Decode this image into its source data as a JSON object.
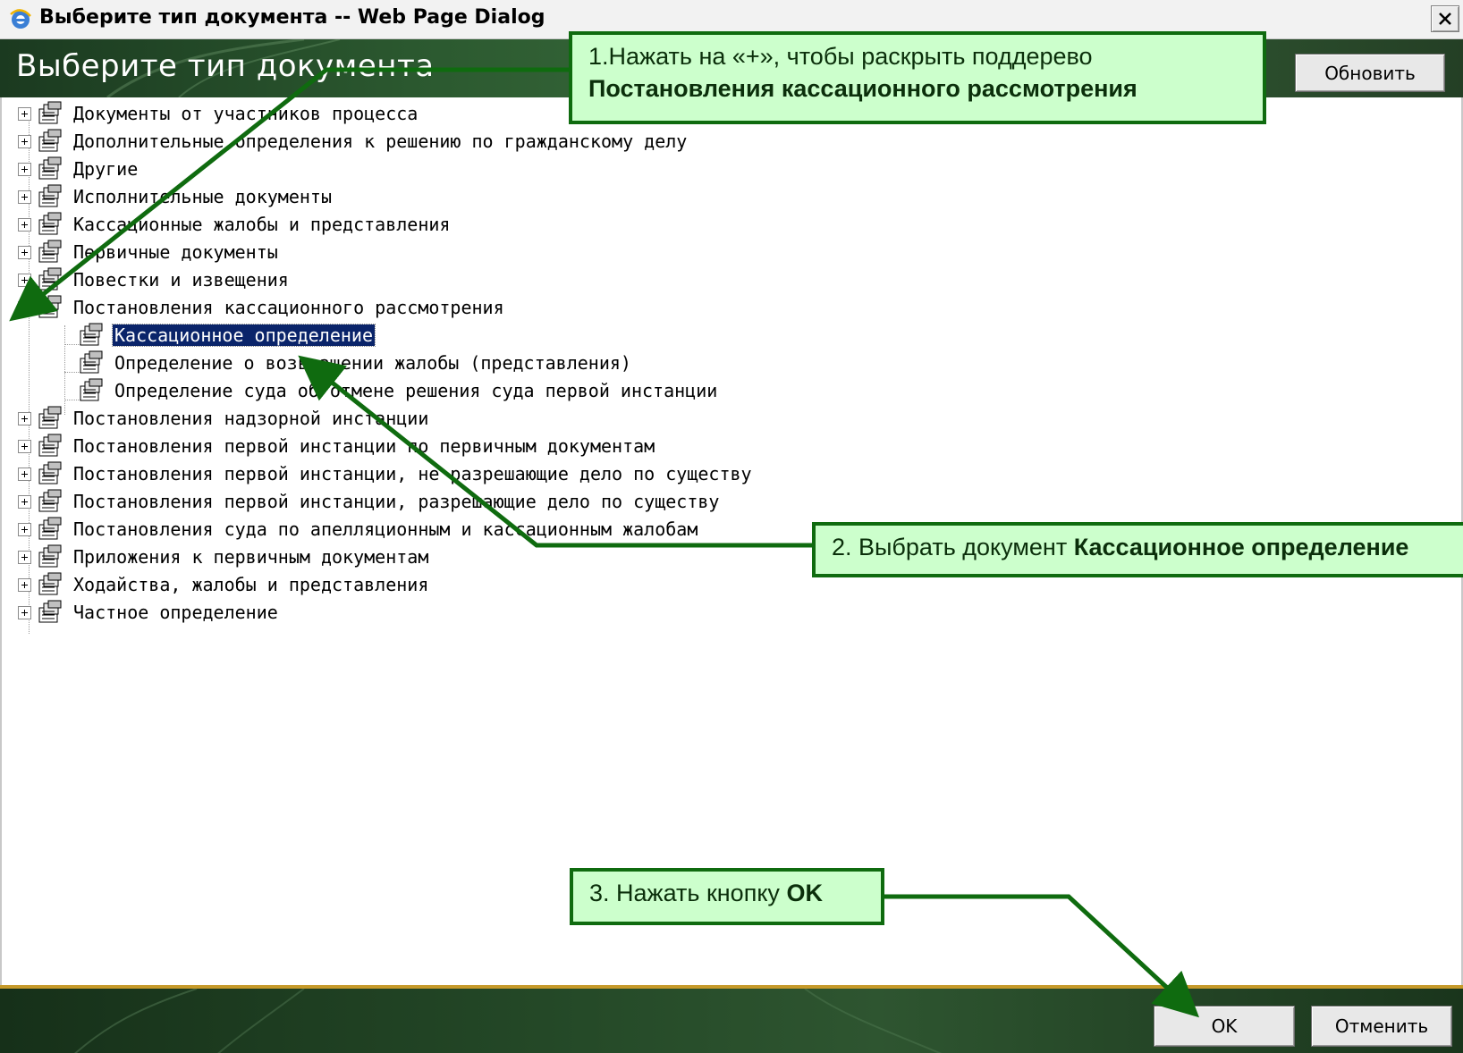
{
  "window": {
    "title": "Выберите тип документа -- Web Page Dialog",
    "icons": {
      "app": "ie-icon",
      "close": "close-icon"
    }
  },
  "header": {
    "title": "Выберите тип документа",
    "refresh_label": "Обновить"
  },
  "tree": {
    "expander_icons": {
      "collapsed": "plus-icon",
      "expanded": "minus-icon"
    },
    "node_icon": "document-type-icon",
    "nodes": [
      {
        "label": "Документы от участников процесса",
        "expanded": false
      },
      {
        "label": "Дополнительные определения к решению по гражданскому делу",
        "expanded": false
      },
      {
        "label": "Другие",
        "expanded": false
      },
      {
        "label": "Исполнительные документы",
        "expanded": false
      },
      {
        "label": "Кассационные жалобы и представления",
        "expanded": false
      },
      {
        "label": "Первичные документы",
        "expanded": false
      },
      {
        "label": "Повестки и извещения",
        "expanded": false
      },
      {
        "label": "Постановления кассационного рассмотрения",
        "expanded": true,
        "children": [
          {
            "label": "Кассационное определение",
            "selected": true
          },
          {
            "label": "Определение о возвращении жалобы (представления)"
          },
          {
            "label": "Определение суда об отмене решения суда первой инстанции"
          }
        ]
      },
      {
        "label": "Постановления надзорной инстанции",
        "expanded": false
      },
      {
        "label": "Постановления первой инстанции по первичным документам",
        "expanded": false
      },
      {
        "label": "Постановления первой инстанции, не разрешающие дело по существу",
        "expanded": false
      },
      {
        "label": "Постановления первой инстанции, разрешающие дело по существу",
        "expanded": false
      },
      {
        "label": "Постановления суда по апелляционным и кассационным жалобам",
        "expanded": false
      },
      {
        "label": "Приложения к первичным документам",
        "expanded": false
      },
      {
        "label": "Ходайства, жалобы и представления",
        "expanded": false
      },
      {
        "label": "Частное определение",
        "expanded": false
      }
    ]
  },
  "footer": {
    "ok_label": "OK",
    "cancel_label": "Отменить"
  },
  "callouts": {
    "step1_line1": "1.Нажать на «+», чтобы раскрыть поддерево",
    "step1_line2": "Постановления кассационного рассмотрения",
    "step2_prefix": "2. Выбрать документ ",
    "step2_bold": "Кассационное определение",
    "step3_prefix": "3. Нажать кнопку ",
    "step3_bold": "OK"
  },
  "colors": {
    "callout_bg": "#ccffcc",
    "callout_border": "#0f6b0f",
    "selection": "#0a246a",
    "header_green": "#2c5a30",
    "footer_stripe": "#c69a2a"
  }
}
